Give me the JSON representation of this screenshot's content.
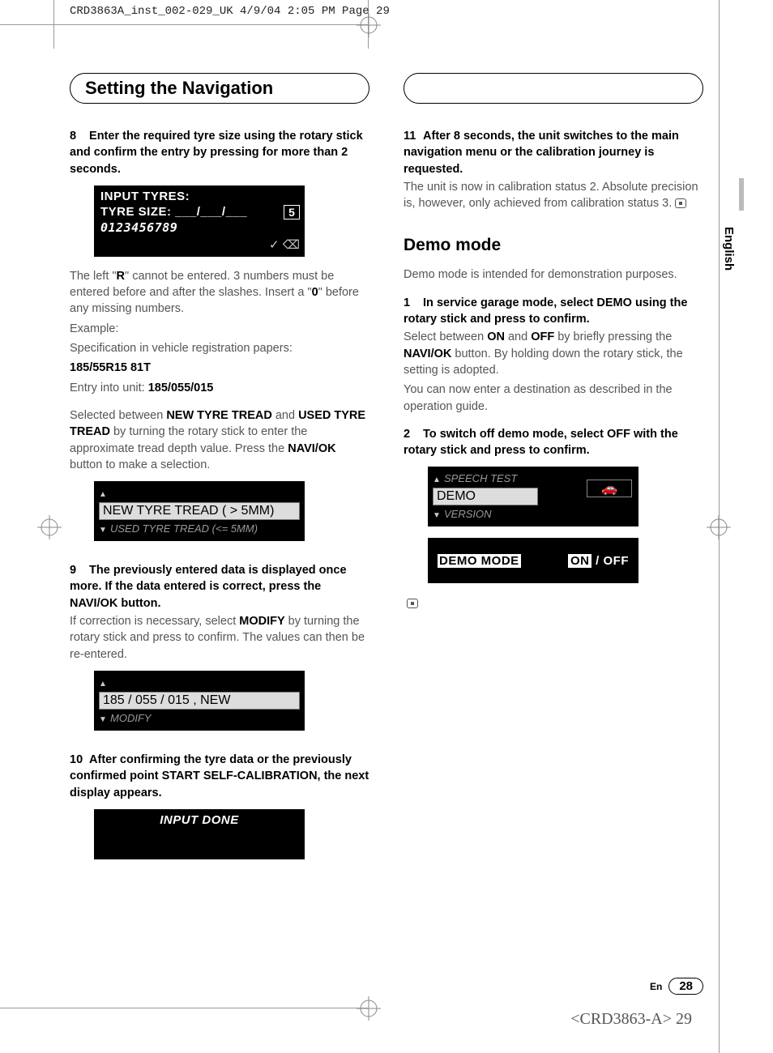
{
  "slug": "CRD3863A_inst_002-029_UK  4/9/04 2:05 PM  Page 29",
  "header_left": "Setting the Navigation",
  "side_tab": "English",
  "step8": {
    "num": "8",
    "bold": "Enter the required tyre size using the rotary stick and confirm the entry by pressing for more than 2 seconds."
  },
  "lcd1": {
    "line1": "INPUT TYRES:",
    "line2": "TYRE SIZE:  ___/___/___",
    "line3": "0123456789",
    "boxed": "5",
    "check": "✓    ⌫"
  },
  "para8a": "The left \"R\" cannot be entered. 3 numbers must be entered before and after the slashes. Insert a \"0\" before any missing numbers.",
  "para8b": "Example:",
  "para8c": "Specification in vehicle registration papers:",
  "spec": "185/55R15 81T",
  "para8d_pre": "Entry into unit: ",
  "para8d_bold": "185/055/015",
  "para8e": "Selected between NEW TYRE TREAD and USED TYRE TREAD by turning the rotary stick to enter the approximate tread depth value. Press the NAVI/OK button to make a selection.",
  "lcd2": {
    "tri_up": "▲",
    "line1": "NEW TYRE TREAD ( > 5MM)",
    "tri_dn": "▼",
    "line2": "USED TYRE TREAD (<= 5MM)"
  },
  "step9": {
    "num": "9",
    "bold": "The previously entered data is displayed once more. If the data entered is correct, press the NAVI/OK button."
  },
  "para9a": "If correction is necessary, select MODIFY by turning the rotary stick and press to confirm. The values can then be re-entered.",
  "lcd3": {
    "tri_up": "▲",
    "line1": "185 / 055 / 015 , NEW",
    "tri_dn": "▼",
    "line2": "MODIFY"
  },
  "step10": {
    "num": "10",
    "bold": "After confirming the tyre data or the previously confirmed point START SELF-CALIBRATION, the next display appears."
  },
  "lcd4": {
    "line1": "INPUT  DONE"
  },
  "step11": {
    "num": "11",
    "bold": "After 8 seconds, the unit switches to the main navigation menu or the calibration journey is requested."
  },
  "para11": "The unit is now in calibration status 2. Absolute precision is, however, only achieved from calibration status 3.  ",
  "demo_h": "Demo mode",
  "demo_intro": "Demo mode is intended for demonstration purposes.",
  "dstep1": {
    "num": "1",
    "bold": "In service garage mode, select DEMO using the rotary stick and press to confirm."
  },
  "dpara1": "Select between ON and OFF by briefly pressing the NAVI/OK button. By holding down the rotary stick, the setting is adopted.",
  "dpara2": "You can now enter a destination as described in the operation guide.",
  "dstep2": {
    "num": "2",
    "bold": "To switch off demo mode, select OFF with the rotary stick and press to confirm."
  },
  "lcd5": {
    "tri_up": "▲",
    "line_up": "SPEECH TEST",
    "line_sel": "DEMO",
    "tri_dn": "▼",
    "line_dn": "VERSION"
  },
  "lcd6": {
    "label": "DEMO  MODE",
    "on": "ON",
    "sep": " / ",
    "off": "OFF"
  },
  "footer": {
    "en": "En",
    "pg": "28"
  },
  "crd_footer": "<CRD3863-A> 29"
}
